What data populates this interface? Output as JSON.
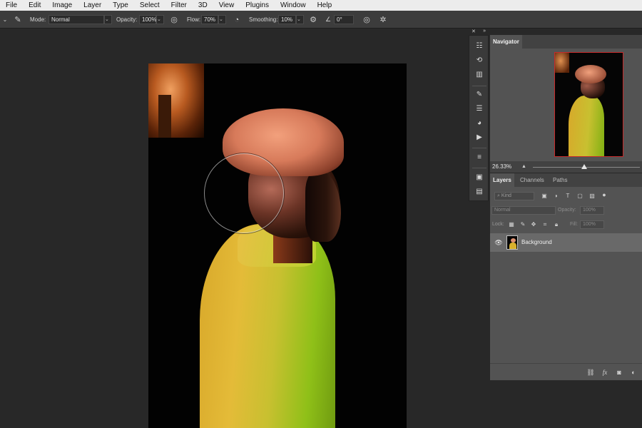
{
  "menu": [
    "File",
    "Edit",
    "Image",
    "Layer",
    "Type",
    "Select",
    "Filter",
    "3D",
    "View",
    "Plugins",
    "Window",
    "Help"
  ],
  "options": {
    "mode_label": "Mode:",
    "mode_value": "Normal",
    "opacity_label": "Opacity:",
    "opacity_value": "100%",
    "flow_label": "Flow:",
    "flow_value": "70%",
    "smoothing_label": "Smoothing:",
    "smoothing_value": "10%",
    "angle_value": "0°"
  },
  "tool_strip_icons": [
    "adjustments-icon",
    "history-icon",
    "libraries-icon",
    "brush-settings-icon",
    "brush-presets-icon",
    "color-icon",
    "actions-icon",
    "properties-icon",
    "info-icon",
    "notes-icon"
  ],
  "navigator": {
    "tab_label": "Navigator",
    "zoom": "26.33%",
    "zoom_fraction": 0.48
  },
  "layers": {
    "tabs": [
      "Layers",
      "Channels",
      "Paths"
    ],
    "kind_placeholder": "Kind",
    "blend_mode": "Normal",
    "opacity_label": "Opacity:",
    "opacity_value": "100%",
    "lock_label": "Lock:",
    "fill_label": "Fill:",
    "fill_value": "100%",
    "layer_name": "Background"
  },
  "colors": {
    "menubar": "#ececec",
    "optionsbar": "#3c3c3c",
    "workspace": "#282828",
    "panel": "#535353",
    "selected_layer": "#696969"
  }
}
